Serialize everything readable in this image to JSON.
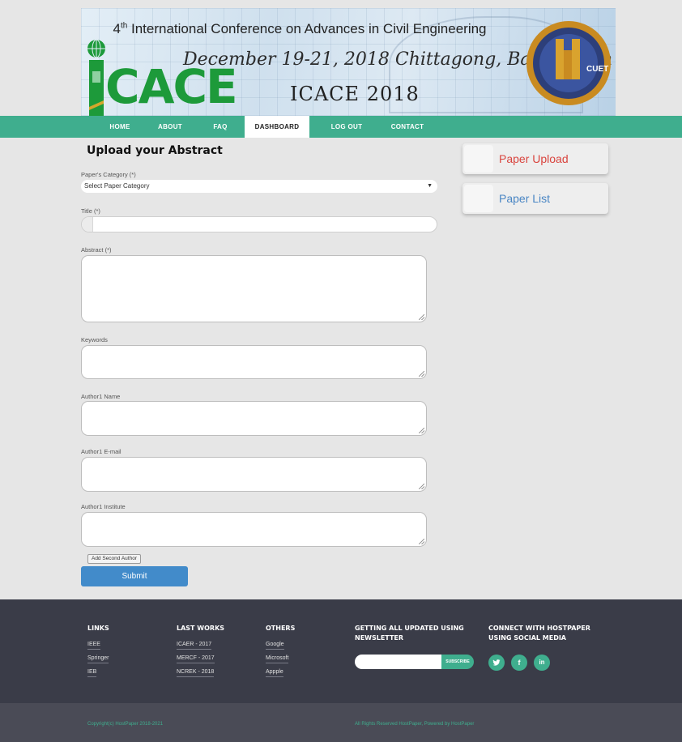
{
  "banner": {
    "line1_prefix": "4",
    "line1_sup": "th",
    "line1_rest": " International Conference on Advances in Civil Engineering",
    "line2": "December 19-21, 2018 Chittagong,  Bangladesh",
    "line3": "ICACE 2018",
    "logo_text": "CACE",
    "seal_text": "CUET",
    "brand_green": "#1d9a3a"
  },
  "nav": {
    "items": [
      "HOME",
      "ABOUT",
      "FAQ",
      "DASHBOARD",
      "LOG OUT",
      "CONTACT"
    ],
    "active": "DASHBOARD",
    "color": "#3fae8e"
  },
  "form": {
    "title": "Upload your Abstract",
    "category_label": "Paper's Category (*)",
    "category_value": "Select Paper Category",
    "title_label": "Title (*)",
    "title_value": "",
    "abstract_label": "Abstract (*)",
    "keywords_label": "Keywords",
    "author_name_label": "Author1 Name",
    "author_email_label": "Author1 E-mail",
    "author_institute_label": "Author1 Institute",
    "add_author_label": "Add Second Author",
    "submit_label": "Submit"
  },
  "side": {
    "paper_upload": "Paper Upload",
    "paper_list": "Paper List",
    "upload_color": "#d9443e",
    "list_color": "#4a86c4"
  },
  "footer": {
    "links_title": "LINKS",
    "links": [
      "IEEE",
      "Springer",
      "IEB"
    ],
    "last_works_title": "LAST WORKS",
    "last_works": [
      "ICAER - 2017",
      "MERCF - 2017",
      "NCREK - 2018"
    ],
    "others_title": "OTHERS",
    "others": [
      "Google",
      "Microsoft",
      "Appple"
    ],
    "newsletter_title_1": "GETTING ALL UPDATED USING",
    "newsletter_title_2": "NEWSLETTER",
    "subscribe_label": "SUBSCRIBE",
    "social_title_1": "CONNECT WITH HOSTPAPER",
    "social_title_2": "USING SOCIAL MEDIA",
    "social_icons": [
      "twitter-icon",
      "facebook-icon",
      "linkedin-icon"
    ],
    "copyright": "Copyright(c) HostPaper 2018-2021",
    "rights": "All Rights Reserved HostPaper, Powered by HostPaper"
  }
}
